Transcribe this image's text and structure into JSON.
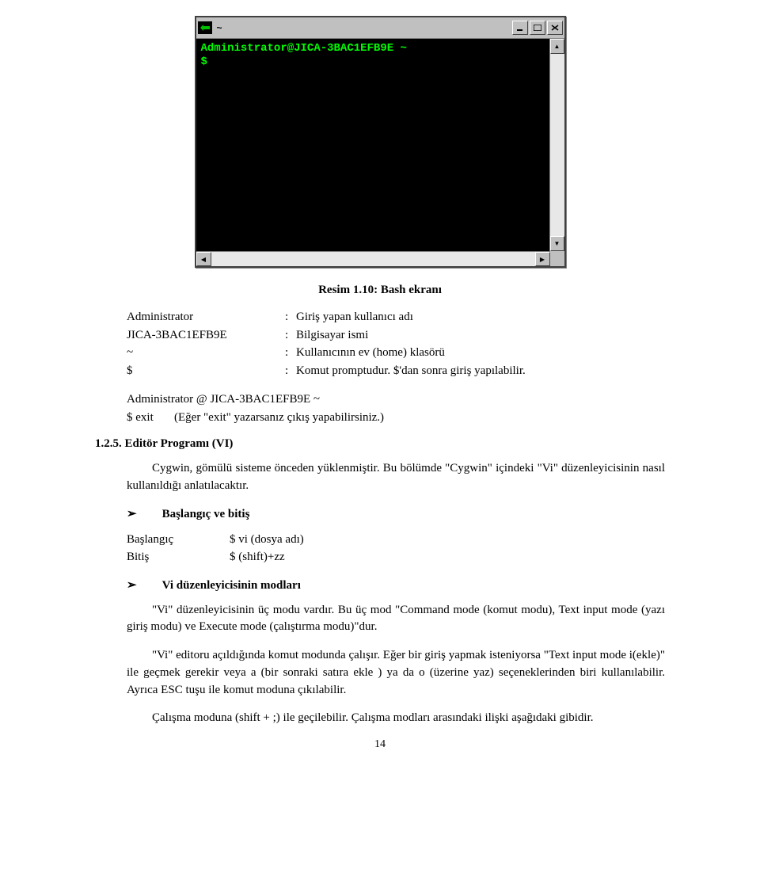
{
  "terminal": {
    "title": "~",
    "prompt_line1": "Administrator@JICA-3BAC1EFB9E ~",
    "prompt_line2": "$"
  },
  "caption": "Resim 1.10: Bash ekranı",
  "definitions": [
    {
      "term": "Administrator",
      "def": "Giriş yapan kullanıcı adı"
    },
    {
      "term": "JICA-3BAC1EFB9E",
      "def": "Bilgisayar ismi"
    },
    {
      "term": "~",
      "def": "Kullanıcının ev (home) klasörü"
    },
    {
      "term": "$",
      "def": "Komut promptudur. $'dan sonra giriş yapılabilir."
    }
  ],
  "admin_prompt": "Administrator @ JICA-3BAC1EFB9E    ~",
  "exit_line_prefix": "$ exit",
  "exit_line_note": "(Eğer \"exit\" yazarsanız çıkış yapabilirsiniz.)",
  "section_number": "1.2.5. Editör Programı (VI)",
  "cygwin_para": "Cygwin, gömülü sisteme önceden yüklenmiştir. Bu bölümde \"Cygwin\" içindeki \"Vi\" düzenleyicisinin nasıl kullanıldığı anlatılacaktır.",
  "bullet1": "Başlangıç ve bitiş",
  "startend": {
    "start_label": "Başlangıç",
    "start_val": "$ vi (dosya adı)",
    "end_label": "Bitiş",
    "end_val": "$ (shift)+zz"
  },
  "bullet2": "Vi düzenleyicisinin modları",
  "modes_para1": "\"Vi\" düzenleyicisinin üç modu vardır. Bu üç mod \"Command mode (komut modu), Text input mode (yazı giriş modu) ve Execute mode (çalıştırma modu)\"dur.",
  "modes_para2": "\"Vi\" editoru açıldığında komut modunda çalışır.   Eğer bir giriş yapmak isteniyorsa \"Text input mode i(ekle)\" ile geçmek gerekir veya a (bir sonraki satıra ekle ) ya da o (üzerine yaz) seçeneklerinden biri kullanılabilir. Ayrıca ESC tuşu ile komut moduna çıkılabilir.",
  "modes_para3": "Çalışma moduna (shift + ;) ile geçilebilir. Çalışma modları arasındaki ilişki aşağıdaki gibidir.",
  "page_number": "14"
}
